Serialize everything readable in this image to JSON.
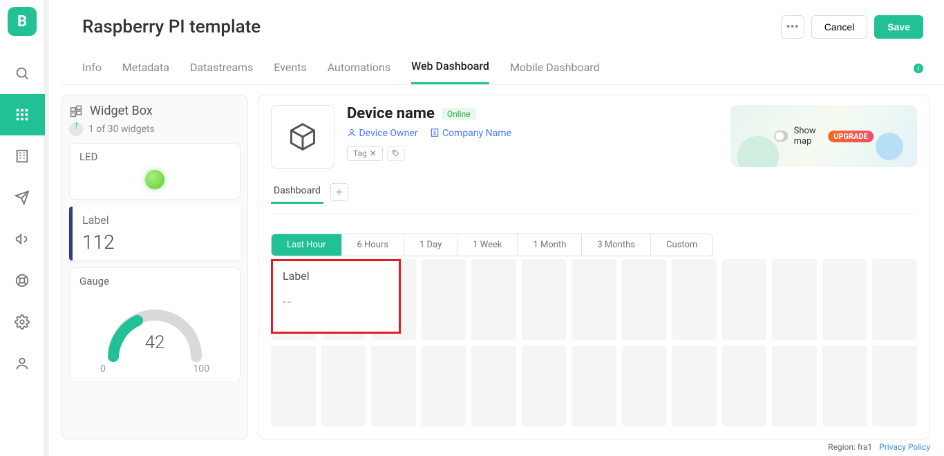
{
  "logo_letter": "B",
  "page_title": "Raspberry PI template",
  "header": {
    "more_glyph": "•••",
    "cancel": "Cancel",
    "save": "Save"
  },
  "tabs": [
    "Info",
    "Metadata",
    "Datastreams",
    "Events",
    "Automations",
    "Web Dashboard",
    "Mobile Dashboard"
  ],
  "tabs_active_index": 5,
  "widget_box": {
    "title": "Widget Box",
    "count_text": "1 of 30 widgets",
    "widgets": {
      "led": {
        "title": "LED"
      },
      "label": {
        "title": "Label",
        "value": "112"
      },
      "gauge": {
        "title": "Gauge",
        "value": "42",
        "min": "0",
        "max": "100"
      }
    }
  },
  "device": {
    "name": "Device name",
    "status": "Online",
    "owner_label": "Device Owner",
    "company_label": "Company Name",
    "tag_text": "Tag",
    "show_map": "Show map",
    "upgrade": "UPGRADE"
  },
  "dashboard": {
    "tab_label": "Dashboard",
    "add_glyph": "+",
    "time_options": [
      "Last Hour",
      "6 Hours",
      "1 Day",
      "1 Week",
      "1 Month",
      "3 Months",
      "Custom"
    ],
    "time_active_index": 0,
    "label_widget": {
      "title": "Label",
      "value": "--"
    }
  },
  "footer": {
    "region": "Region: fra1",
    "privacy": "Privacy Policy"
  }
}
